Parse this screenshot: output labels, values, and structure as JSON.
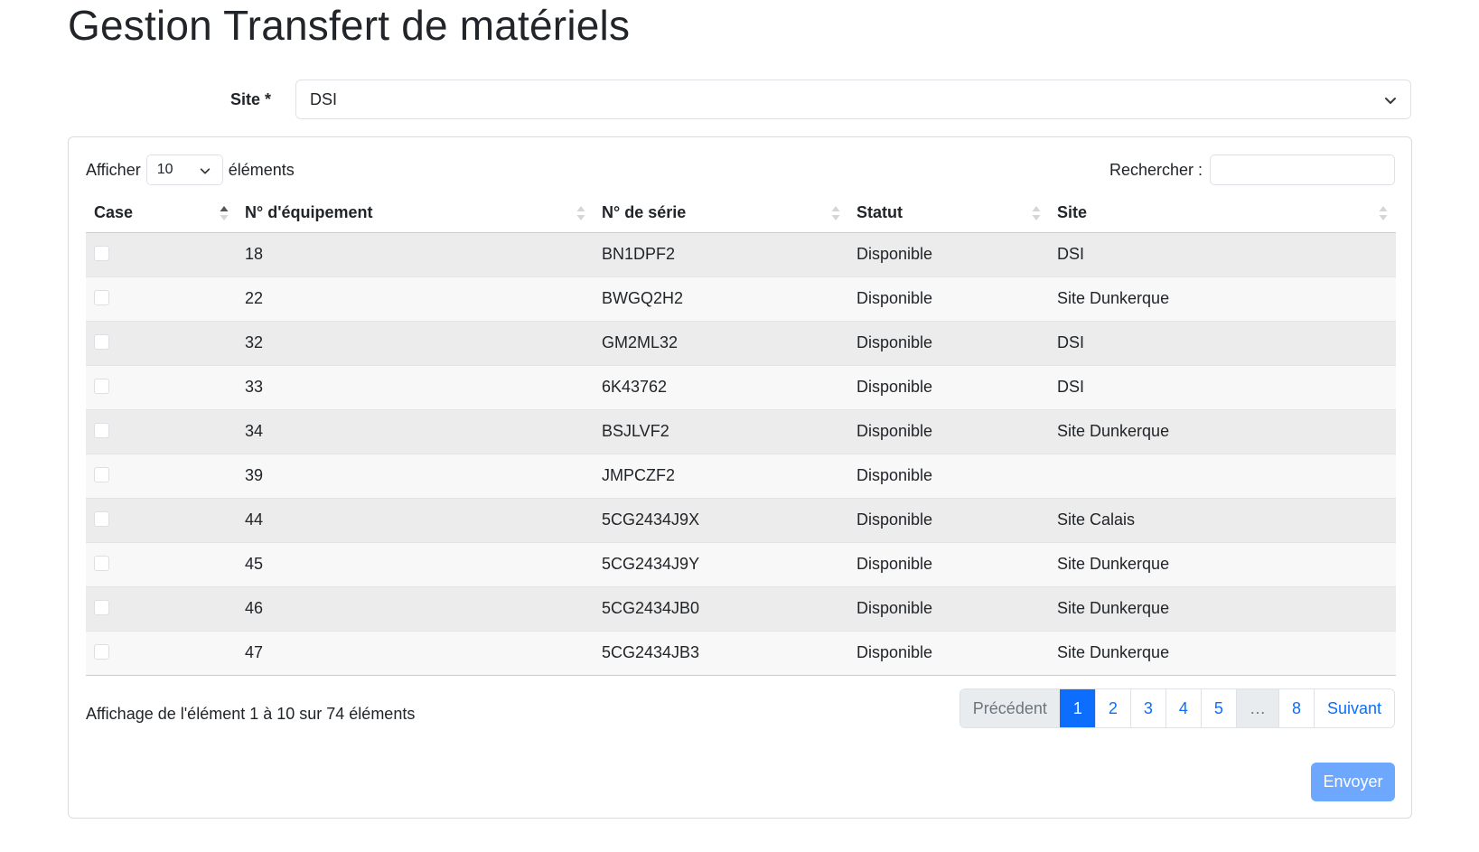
{
  "page": {
    "title": "Gestion Transfert de matériels"
  },
  "site_field": {
    "label": "Site *",
    "value": "DSI"
  },
  "length_control": {
    "prefix": "Afficher",
    "value": "10",
    "suffix": "éléments"
  },
  "search": {
    "label": "Rechercher :",
    "value": ""
  },
  "table": {
    "columns": [
      "Case",
      "N° d'équipement",
      "N° de série",
      "Statut",
      "Site"
    ],
    "sorted_column": "Case",
    "rows": [
      {
        "checked": false,
        "equipment": "18",
        "serial": "BN1DPF2",
        "status": "Disponible",
        "site": "DSI"
      },
      {
        "checked": false,
        "equipment": "22",
        "serial": "BWGQ2H2",
        "status": "Disponible",
        "site": "Site Dunkerque"
      },
      {
        "checked": false,
        "equipment": "32",
        "serial": "GM2ML32",
        "status": "Disponible",
        "site": "DSI"
      },
      {
        "checked": false,
        "equipment": "33",
        "serial": "6K43762",
        "status": "Disponible",
        "site": "DSI"
      },
      {
        "checked": false,
        "equipment": "34",
        "serial": "BSJLVF2",
        "status": "Disponible",
        "site": "Site Dunkerque"
      },
      {
        "checked": false,
        "equipment": "39",
        "serial": "JMPCZF2",
        "status": "Disponible",
        "site": ""
      },
      {
        "checked": false,
        "equipment": "44",
        "serial": "5CG2434J9X",
        "status": "Disponible",
        "site": "Site Calais"
      },
      {
        "checked": false,
        "equipment": "45",
        "serial": "5CG2434J9Y",
        "status": "Disponible",
        "site": "Site Dunkerque"
      },
      {
        "checked": false,
        "equipment": "46",
        "serial": "5CG2434JB0",
        "status": "Disponible",
        "site": "Site Dunkerque"
      },
      {
        "checked": false,
        "equipment": "47",
        "serial": "5CG2434JB3",
        "status": "Disponible",
        "site": "Site Dunkerque"
      }
    ]
  },
  "info": "Affichage de l'élément 1 à 10 sur 74 éléments",
  "pagination": {
    "previous": "Précédent",
    "pages": [
      "1",
      "2",
      "3",
      "4",
      "5",
      "…",
      "8"
    ],
    "current": "1",
    "next": "Suivant"
  },
  "submit_label": "Envoyer",
  "colors": {
    "primary": "#0d6efd",
    "submit_disabled": "#6ea8fe",
    "row_odd": "#ececec",
    "row_even": "#f8f8f8"
  }
}
